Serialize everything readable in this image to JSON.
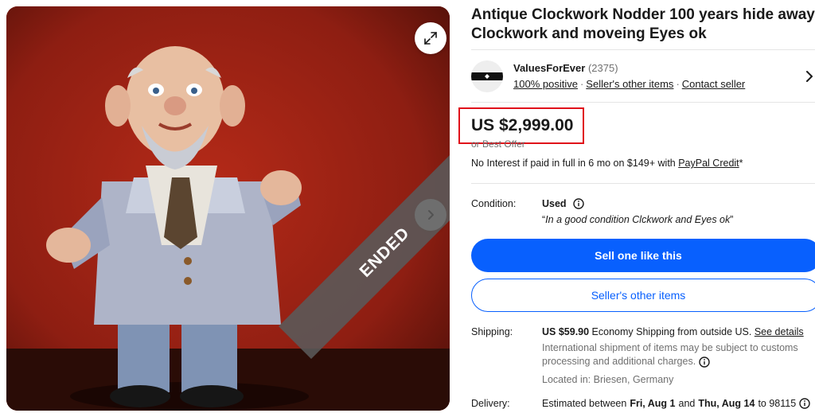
{
  "image": {
    "description_icon": "doll-photo",
    "ended_label": "ENDED"
  },
  "listing": {
    "title": "Antique Clockwork Nodder 100 years hide away Clockwork and moveing Eyes ok"
  },
  "seller": {
    "name": "ValuesForEver",
    "feedback_count": "(2375)",
    "positive": "100% positive",
    "other_items": "Seller's other items",
    "contact": "Contact seller"
  },
  "price": {
    "amount": "US $2,999.00",
    "best_offer": "or Best Offer"
  },
  "financing": {
    "text": "No Interest if paid in full in 6 mo on $149+ with ",
    "link": "PayPal Credit",
    "suffix": "*"
  },
  "condition": {
    "label": "Condition:",
    "value": "Used",
    "open_quote": "“",
    "note": "In a good condition Clckwork and Eyes ok",
    "close_quote": "”"
  },
  "buttons": {
    "primary": "Sell one like this",
    "secondary": "Seller's other items"
  },
  "shipping": {
    "label": "Shipping:",
    "cost": "US $59.90",
    "method": " Economy Shipping from outside US. ",
    "details_link": "See details",
    "intl_note": "International shipment of items may be subject to customs processing and additional charges.",
    "located": "Located in: Briesen, Germany"
  },
  "delivery": {
    "label": "Delivery:",
    "prefix": "Estimated between ",
    "start": "Fri, Aug 1",
    "and": " and ",
    "end": "Thu, Aug 14",
    "to": " to 98115"
  },
  "colors": {
    "primary_button": "#0860fe",
    "highlight_box": "#e0101a",
    "photo_background": "#8e1e12"
  }
}
